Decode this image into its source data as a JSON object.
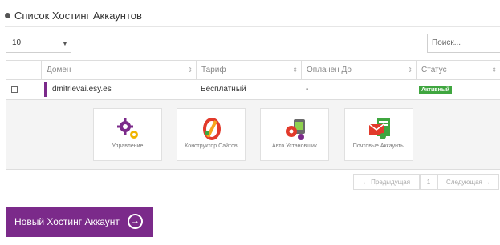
{
  "page": {
    "title": "Список Хостинг Аккаунтов"
  },
  "controls": {
    "page_length": "10",
    "search_placeholder": "Поиск..."
  },
  "table": {
    "columns": [
      "Домен",
      "Тариф",
      "Оплачен До",
      "Статус"
    ],
    "rows": [
      {
        "domain": "dmitrievai.esy.es",
        "plan": "Бесплатный",
        "paid_until": "-",
        "status": "Активный"
      }
    ]
  },
  "tiles": [
    {
      "label": "Управление",
      "icon": "gears-icon"
    },
    {
      "label": "Конструктор Сайтов",
      "icon": "website-builder-icon"
    },
    {
      "label": "Авто Установщик",
      "icon": "auto-installer-icon"
    },
    {
      "label": "Почтовые Аккаунты",
      "icon": "email-accounts-icon"
    }
  ],
  "pagination": {
    "prev": "← Предыдущая",
    "page": "1",
    "next": "Следующая →"
  },
  "new_account_button": {
    "label": "Новый Хостинг Аккаунт",
    "icon": "arrow-right-circle-icon"
  },
  "colors": {
    "accent": "#7b2a8a",
    "status_active": "#3fa63f",
    "panel_bg": "#f4f4f4"
  }
}
